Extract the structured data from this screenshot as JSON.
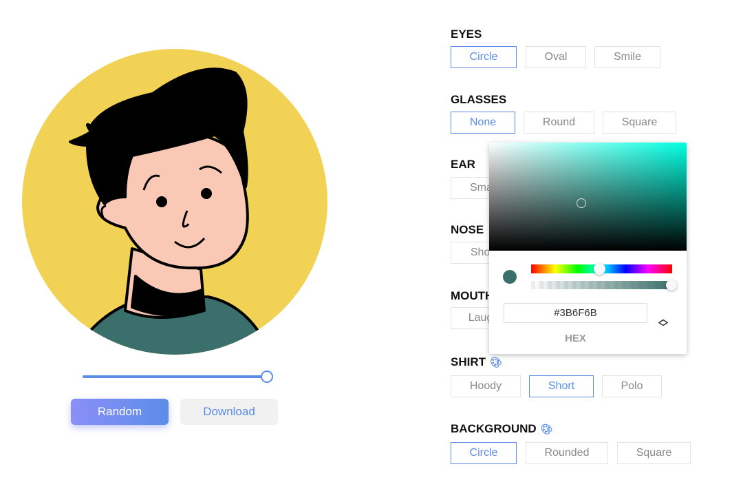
{
  "preview": {
    "shirt_color": "#3B6F6B",
    "background_color": "#F2D255",
    "skin_color": "#F9C9B6"
  },
  "controls": {
    "random_label": "Random",
    "download_label": "Download",
    "size_slider_value": 1.0
  },
  "sections": [
    {
      "title": "EYES",
      "options": [
        "Circle",
        "Oval",
        "Smile"
      ],
      "selected": "Circle"
    },
    {
      "title": "GLASSES",
      "options": [
        "None",
        "Round",
        "Square"
      ],
      "selected": "None"
    },
    {
      "title": "EAR",
      "options": [
        "Small"
      ]
    },
    {
      "title": "NOSE",
      "options": [
        "Short"
      ]
    },
    {
      "title": "MOUTH",
      "options": [
        "Laugh"
      ]
    },
    {
      "title": "SHIRT",
      "options": [
        "Hoody",
        "Short",
        "Polo"
      ],
      "selected": "Short",
      "has_palette": true
    },
    {
      "title": "BACKGROUND",
      "options": [
        "Circle",
        "Rounded",
        "Square"
      ],
      "selected": "Circle",
      "has_palette": true
    }
  ],
  "color_picker": {
    "hex_value": "#3B6F6B",
    "mode_label": "HEX",
    "accent": "#5B8DE8"
  }
}
